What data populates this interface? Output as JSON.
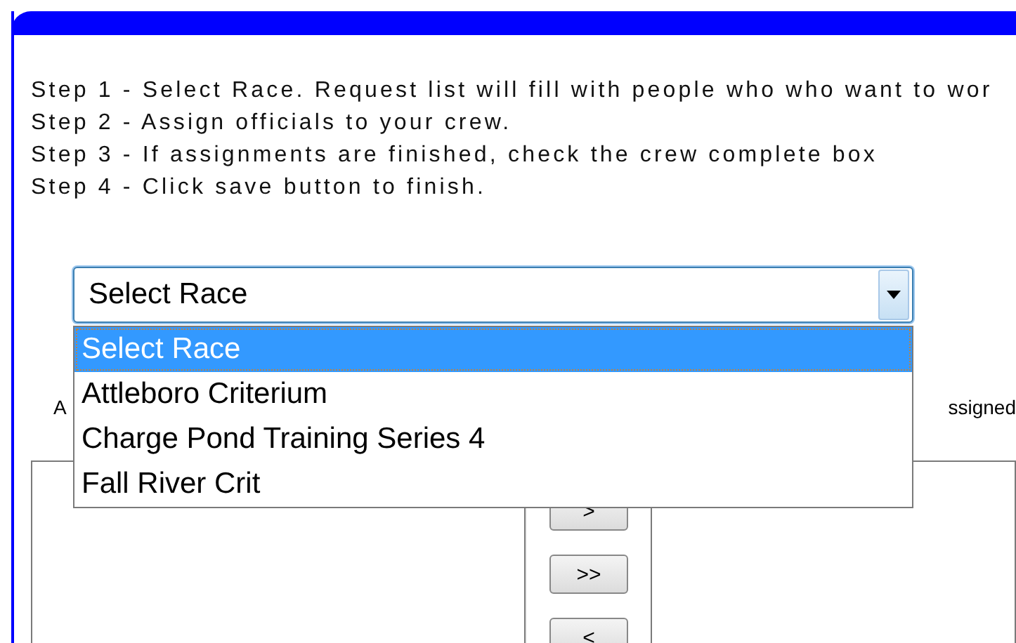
{
  "steps": [
    "Step 1 - Select Race.  Request list will fill with people who who want to wor",
    "Step 2 - Assign officials to your crew.",
    "Step 3 - If assignments are finished, check the crew complete box",
    "Step 4 - Click save button to finish."
  ],
  "race_select": {
    "value": "Select Race",
    "expanded": true,
    "options": [
      {
        "label": "Select Race",
        "selected": true
      },
      {
        "label": "Attleboro Criterium",
        "selected": false
      },
      {
        "label": "Charge Pond Training Series 4",
        "selected": false
      },
      {
        "label": "Fall River Crit",
        "selected": false
      }
    ]
  },
  "left_label": "A",
  "right_label": "ssigned",
  "move_buttons": [
    ">",
    ">>",
    "<"
  ]
}
